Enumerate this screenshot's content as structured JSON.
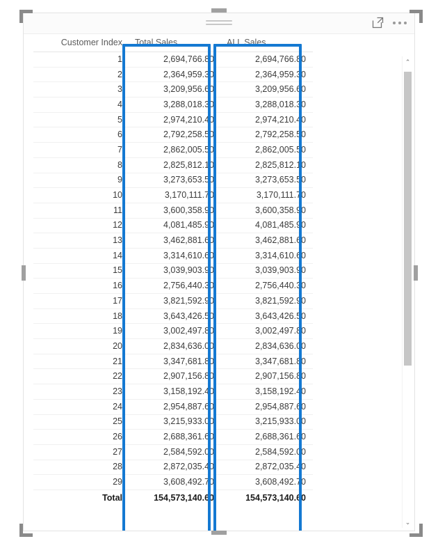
{
  "visual": {
    "type": "power-bi-table-visual",
    "accent_color": "#1479d2",
    "header": {
      "drag_handle_name": "drag-handle",
      "focus_mode_label": "Focus mode",
      "more_options_label": "More options"
    }
  },
  "table": {
    "columns": [
      {
        "key": "customer_index",
        "label": "Customer Index",
        "align": "right",
        "highlighted": false
      },
      {
        "key": "total_sales",
        "label": "Total Sales",
        "align": "right",
        "highlighted": true
      },
      {
        "key": "all_sales",
        "label": "ALL Sales",
        "align": "right",
        "highlighted": true
      }
    ],
    "rows": [
      {
        "customer_index": "1",
        "total_sales": "2,694,766.80",
        "all_sales": "2,694,766.80"
      },
      {
        "customer_index": "2",
        "total_sales": "2,364,959.30",
        "all_sales": "2,364,959.30"
      },
      {
        "customer_index": "3",
        "total_sales": "3,209,956.60",
        "all_sales": "3,209,956.60"
      },
      {
        "customer_index": "4",
        "total_sales": "3,288,018.30",
        "all_sales": "3,288,018.30"
      },
      {
        "customer_index": "5",
        "total_sales": "2,974,210.40",
        "all_sales": "2,974,210.40"
      },
      {
        "customer_index": "6",
        "total_sales": "2,792,258.50",
        "all_sales": "2,792,258.50"
      },
      {
        "customer_index": "7",
        "total_sales": "2,862,005.50",
        "all_sales": "2,862,005.50"
      },
      {
        "customer_index": "8",
        "total_sales": "2,825,812.10",
        "all_sales": "2,825,812.10"
      },
      {
        "customer_index": "9",
        "total_sales": "3,273,653.50",
        "all_sales": "3,273,653.50"
      },
      {
        "customer_index": "10",
        "total_sales": "3,170,111.70",
        "all_sales": "3,170,111.70"
      },
      {
        "customer_index": "11",
        "total_sales": "3,600,358.90",
        "all_sales": "3,600,358.90"
      },
      {
        "customer_index": "12",
        "total_sales": "4,081,485.90",
        "all_sales": "4,081,485.90"
      },
      {
        "customer_index": "13",
        "total_sales": "3,462,881.60",
        "all_sales": "3,462,881.60"
      },
      {
        "customer_index": "14",
        "total_sales": "3,314,610.60",
        "all_sales": "3,314,610.60"
      },
      {
        "customer_index": "15",
        "total_sales": "3,039,903.90",
        "all_sales": "3,039,903.90"
      },
      {
        "customer_index": "16",
        "total_sales": "2,756,440.30",
        "all_sales": "2,756,440.30"
      },
      {
        "customer_index": "17",
        "total_sales": "3,821,592.90",
        "all_sales": "3,821,592.90"
      },
      {
        "customer_index": "18",
        "total_sales": "3,643,426.50",
        "all_sales": "3,643,426.50"
      },
      {
        "customer_index": "19",
        "total_sales": "3,002,497.80",
        "all_sales": "3,002,497.80"
      },
      {
        "customer_index": "20",
        "total_sales": "2,834,636.00",
        "all_sales": "2,834,636.00"
      },
      {
        "customer_index": "21",
        "total_sales": "3,347,681.80",
        "all_sales": "3,347,681.80"
      },
      {
        "customer_index": "22",
        "total_sales": "2,907,156.80",
        "all_sales": "2,907,156.80"
      },
      {
        "customer_index": "23",
        "total_sales": "3,158,192.40",
        "all_sales": "3,158,192.40"
      },
      {
        "customer_index": "24",
        "total_sales": "2,954,887.60",
        "all_sales": "2,954,887.60"
      },
      {
        "customer_index": "25",
        "total_sales": "3,215,933.00",
        "all_sales": "3,215,933.00"
      },
      {
        "customer_index": "26",
        "total_sales": "2,688,361.60",
        "all_sales": "2,688,361.60"
      },
      {
        "customer_index": "27",
        "total_sales": "2,584,592.00",
        "all_sales": "2,584,592.00"
      },
      {
        "customer_index": "28",
        "total_sales": "2,872,035.40",
        "all_sales": "2,872,035.40"
      },
      {
        "customer_index": "29",
        "total_sales": "3,608,492.70",
        "all_sales": "3,608,492.70"
      }
    ],
    "total_row": {
      "customer_index": "Total",
      "total_sales": "154,573,140.60",
      "all_sales": "154,573,140.60"
    }
  },
  "scrollbar": {
    "up_arrow_glyph": "⌃",
    "down_arrow_glyph": "⌄",
    "orientation": "vertical"
  }
}
